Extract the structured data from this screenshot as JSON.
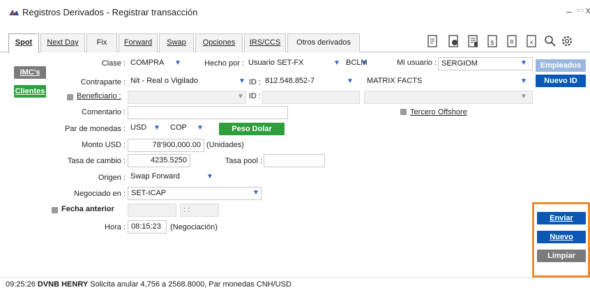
{
  "window": {
    "title": "Registros Derivados - Registrar transacción",
    "controls": {
      "minimize": "–",
      "maximize": "▭",
      "close": "x"
    }
  },
  "tabs": [
    {
      "label": "Spot",
      "active": true
    },
    {
      "label": "Next Day",
      "active": false
    },
    {
      "label": "Fix",
      "active": false
    },
    {
      "label": "Forward",
      "active": false
    },
    {
      "label": "Swap",
      "active": false
    },
    {
      "label": "Opciones",
      "active": false
    },
    {
      "label": "IRS/CCS",
      "active": false
    },
    {
      "label": "Otros derivados",
      "active": false
    }
  ],
  "toolbar_icons": [
    "edit-document-icon",
    "user-document-icon",
    "list-document-icon",
    "currency-document-icon",
    "r-document-icon",
    "x-document-icon",
    "search-icon",
    "settings-icon"
  ],
  "left_buttons": {
    "imcs": "IMC's",
    "clientes": "Clientes"
  },
  "right_buttons": {
    "empleados": "Empleados",
    "nuevo_id": "Nuevo ID"
  },
  "form": {
    "clase": {
      "label": "Clase :",
      "value": "COMPRA"
    },
    "hecho_por": {
      "label": "Hecho por :",
      "value": "Usuario SET-FX",
      "value2": "BCLM"
    },
    "mi_usuario": {
      "label": "Mi usuario :",
      "value": "SERGIOM"
    },
    "contraparte": {
      "label": "Contraparte :",
      "value": "Nit - Real o Vigilado"
    },
    "id1": {
      "label": "ID :",
      "value": "812.548.852-7"
    },
    "matrix": {
      "value": "MATRIX FACTS"
    },
    "beneficiario": {
      "label": "Beneficiario :",
      "value": ""
    },
    "id2": {
      "label": "ID :",
      "value": ""
    },
    "comentario": {
      "label": "Comentario :",
      "value": ""
    },
    "tercero": {
      "label": "Tercero Offshore"
    },
    "par_monedas": {
      "label": "Par de monedas :",
      "from": "USD",
      "to": "COP",
      "button": "Peso Dolar"
    },
    "monto": {
      "label": "Monto USD :",
      "value": "78'900,000.00",
      "suffix": "(Unidades)"
    },
    "tasa_cambio": {
      "label": "Tasa de cambio :",
      "value": "4235.5250"
    },
    "tasa_pool": {
      "label": "Tasa pool :",
      "value": ""
    },
    "origen": {
      "label": "Origen :",
      "value": "Swap Forward"
    },
    "negociado": {
      "label": "Negociado en :",
      "value": "SET-ICAP"
    },
    "fecha_anterior": {
      "label": "Fecha anterior",
      "time": ": :"
    },
    "hora": {
      "label": "Hora :",
      "value": "08:15:23",
      "suffix": "(Negociación)"
    }
  },
  "actions": {
    "enviar": "Enviar",
    "nuevo": "Nuevo",
    "limpiar": "Limpiar"
  },
  "status": {
    "time": "09:25:26",
    "user": "DVNB HENRY",
    "message": "Solicita anular 4,756 a 2568.8000, Par monedas CNH/USD"
  },
  "colors": {
    "accent_blue": "#0b57b5",
    "accent_green": "#2f9e3c",
    "highlight_orange": "#f08a2c",
    "dropdown_arrow": "#2563c9"
  }
}
